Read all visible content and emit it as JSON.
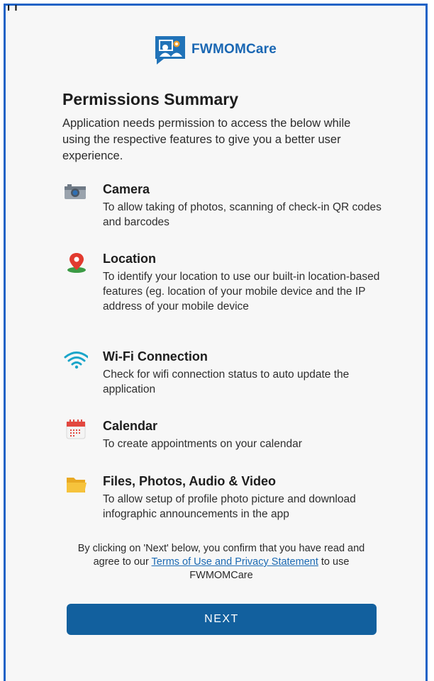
{
  "app": {
    "name": "FWMOMCare",
    "top_glyph": "ı ı"
  },
  "colors": {
    "brand": "#1a67b3",
    "button": "#12609e",
    "border": "#1f63c6"
  },
  "summary": {
    "title": "Permissions Summary",
    "intro": "Application needs permission to access the below while using the respective features to give you a better user experience."
  },
  "permissions": [
    {
      "icon": "camera-icon",
      "title": "Camera",
      "description": "To allow taking of photos, scanning of check-in QR codes and barcodes"
    },
    {
      "icon": "location-pin-icon",
      "title": "Location",
      "description": "To identify your location to use our built-in location-based features (eg. location of your mobile device and the IP address of your mobile device"
    },
    {
      "icon": "wifi-icon",
      "title": "Wi-Fi Connection",
      "description": "Check for wifi connection status to auto update the application"
    },
    {
      "icon": "calendar-icon",
      "title": "Calendar",
      "description": "To create appointments on your calendar"
    },
    {
      "icon": "folder-icon",
      "title": "Files, Photos, Audio & Video",
      "description": "To allow setup of profile photo picture and download infographic announcements in the app"
    }
  ],
  "consent": {
    "prefix": "By clicking on 'Next' below, you confirm that you have read and agree to our ",
    "link": "Terms of Use and Privacy Statement",
    "suffix": " to use FWMOMCare"
  },
  "actions": {
    "next_label": "NEXT"
  }
}
